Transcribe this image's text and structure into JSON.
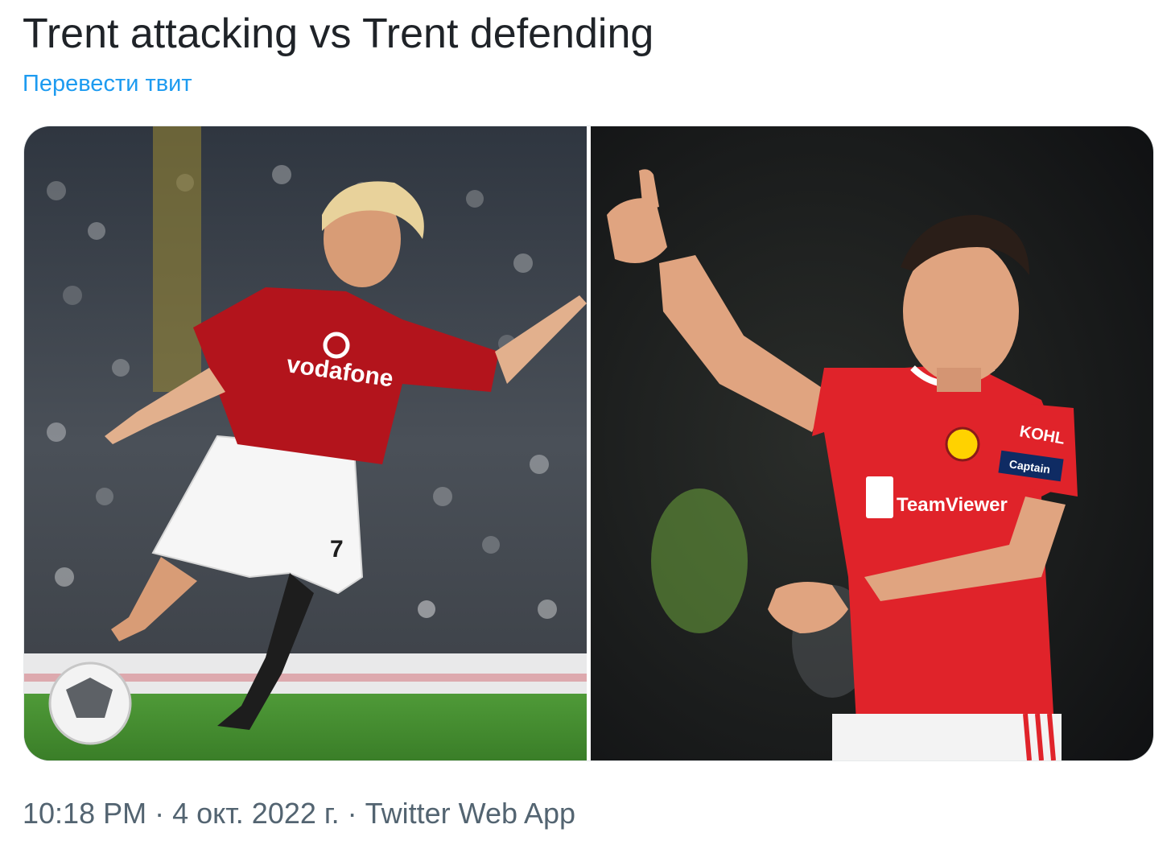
{
  "tweet": {
    "text": "Trent attacking vs Trent defending",
    "translate_label": "Перевести твит"
  },
  "media": [
    {
      "name": "photo-left",
      "icon": "photo-player-kicking-ball",
      "shirt_text": "vodafone",
      "shirt_number": "7"
    },
    {
      "name": "photo-right",
      "icon": "photo-player-thumbs-up",
      "shirt_text": "TeamViewer",
      "sleeve_text": "KOHL",
      "armband_text": "Captain"
    }
  ],
  "meta": {
    "time": "10:18 PM",
    "separator1": " · ",
    "date": "4 окт. 2022 г.",
    "separator2": " · ",
    "source": "Twitter Web App"
  },
  "colors": {
    "text": "#1f2328",
    "link": "#1d9bf0",
    "meta": "#536471",
    "kit_red_old": "#b3141c",
    "kit_red_new": "#e0232a",
    "pitch_green": "#3f8a2e"
  }
}
